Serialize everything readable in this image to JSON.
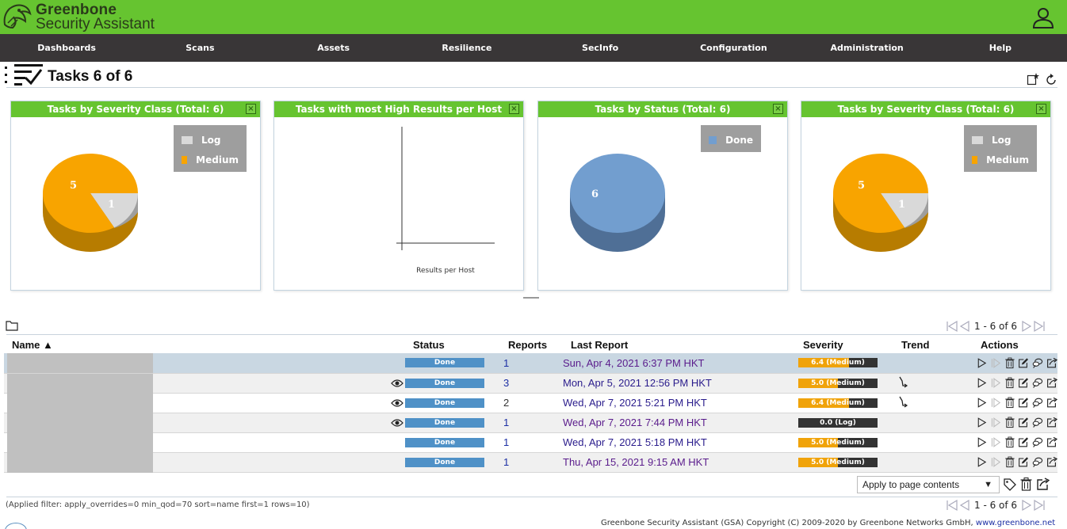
{
  "brand": {
    "line1": "Greenbone",
    "line2": "Security Assistant"
  },
  "nav": [
    "Dashboards",
    "Scans",
    "Assets",
    "Resilience",
    "SecInfo",
    "Configuration",
    "Administration",
    "Help"
  ],
  "page": {
    "title": "Tasks 6 of 6"
  },
  "panels": [
    {
      "title": "Tasks by Severity Class (Total: 6)",
      "legend": [
        "Log",
        "Medium"
      ]
    },
    {
      "title": "Tasks with most High Results per Host",
      "axis_label": "Results per Host"
    },
    {
      "title": "Tasks by Status (Total: 6)",
      "legend": [
        "Done"
      ]
    },
    {
      "title": "Tasks by Severity Class (Total: 6)",
      "legend": [
        "Log",
        "Medium"
      ]
    }
  ],
  "chart_data": [
    {
      "type": "pie",
      "title": "Tasks by Severity Class (Total: 6)",
      "labels": [
        "Log",
        "Medium"
      ],
      "values": [
        1,
        5
      ],
      "colors": [
        "#d9d9d9",
        "#f8a400"
      ]
    },
    {
      "type": "bar",
      "title": "Tasks with most High Results per Host",
      "xlabel": "Results per Host",
      "categories": [],
      "values": []
    },
    {
      "type": "pie",
      "title": "Tasks by Status (Total: 6)",
      "labels": [
        "Done"
      ],
      "values": [
        6
      ],
      "colors": [
        "#729ecf"
      ]
    },
    {
      "type": "pie",
      "title": "Tasks by Severity Class (Total: 6)",
      "labels": [
        "Log",
        "Medium"
      ],
      "values": [
        1,
        5
      ],
      "colors": [
        "#d9d9d9",
        "#f8a400"
      ]
    }
  ],
  "pager": {
    "top": "1 - 6 of 6",
    "bottom": "1 - 6 of 6"
  },
  "table": {
    "headers": {
      "name": "Name ▲",
      "status": "Status",
      "reports": "Reports",
      "last_report": "Last Report",
      "severity": "Severity",
      "trend": "Trend",
      "actions": "Actions"
    },
    "rows": [
      {
        "eye": false,
        "status": "Done",
        "reports": "1",
        "last_report": "Sun, Apr 4, 2021 6:37 PM HKT",
        "severity": "6.4 (Medium)",
        "sev_score": 6.4,
        "sev_color": "#f0a30a",
        "trend": false
      },
      {
        "eye": true,
        "status": "Done",
        "reports": "3",
        "last_report": "Mon, Apr 5, 2021 12:56 PM HKT",
        "severity": "5.0 (Medium)",
        "sev_score": 5.0,
        "sev_color": "#f0a30a",
        "trend": true
      },
      {
        "eye": true,
        "status": "Done",
        "reports": "2",
        "last_report": "Wed, Apr 7, 2021 5:21 PM HKT",
        "severity": "6.4 (Medium)",
        "sev_score": 6.4,
        "sev_color": "#f0a30a",
        "trend": true
      },
      {
        "eye": true,
        "status": "Done",
        "reports": "1",
        "last_report": "Wed, Apr 7, 2021 7:44 PM HKT",
        "severity": "0.0 (Log)",
        "sev_score": 0.0,
        "sev_color": "#f0a30a",
        "trend": false
      },
      {
        "eye": false,
        "status": "Done",
        "reports": "1",
        "last_report": "Wed, Apr 7, 2021 5:18 PM HKT",
        "severity": "5.0 (Medium)",
        "sev_score": 5.0,
        "sev_color": "#f0a30a",
        "trend": false
      },
      {
        "eye": false,
        "status": "Done",
        "reports": "1",
        "last_report": "Thu, Apr 15, 2021 9:15 AM HKT",
        "severity": "5.0 (Medium)",
        "sev_score": 5.0,
        "sev_color": "#f0a30a",
        "trend": false
      }
    ]
  },
  "bulk": {
    "select_value": "Apply to page contents"
  },
  "filter_text": "(Applied filter: apply_overrides=0 min_qod=70 sort=name first=1 rows=10)",
  "footer": {
    "text": "Greenbone Security Assistant (GSA) Copyright (C) 2009-2020 by Greenbone Networks GmbH,",
    "link": "www.greenbone.net"
  }
}
